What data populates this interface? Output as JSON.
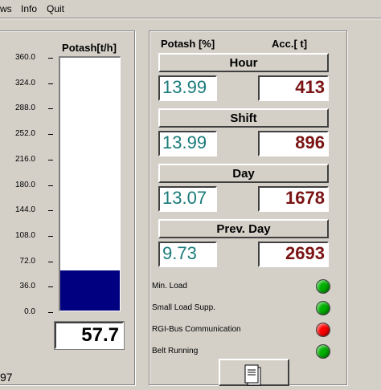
{
  "menu": [
    "ws",
    "Info",
    "Quit"
  ],
  "gauge": {
    "title": "Potash[t/h]",
    "ticks": [
      "360.0",
      "324.0",
      "288.0",
      "252.0",
      "216.0",
      "180.0",
      "144.0",
      "108.0",
      "72.0",
      "36.0",
      "0.0"
    ],
    "value": "57.7",
    "max": 360.0,
    "fill_value": 57.7,
    "fill_color": "#000080"
  },
  "right_panel": {
    "col_pct": "Potash [%]",
    "col_acc": "Acc.[ t]",
    "rows": [
      {
        "label": "Hour",
        "pct": "13.99",
        "acc": "413"
      },
      {
        "label": "Shift",
        "pct": "13.99",
        "acc": "896"
      },
      {
        "label": "Day",
        "pct": "13.07",
        "acc": "1678"
      },
      {
        "label": "Prev. Day",
        "pct": "9.73",
        "acc": "2693"
      }
    ]
  },
  "status": [
    {
      "label": "Min. Load",
      "color": "#00b000"
    },
    {
      "label": "Small Load Supp.",
      "color": "#00b000"
    },
    {
      "label": "RGI-Bus Communication",
      "color": "#ff0000"
    },
    {
      "label": "Belt Running",
      "color": "#00b000"
    }
  ],
  "bottom_left_text": "97",
  "colors": {
    "pct_text": "#1a7a7a",
    "acc_text": "#7a1414"
  }
}
